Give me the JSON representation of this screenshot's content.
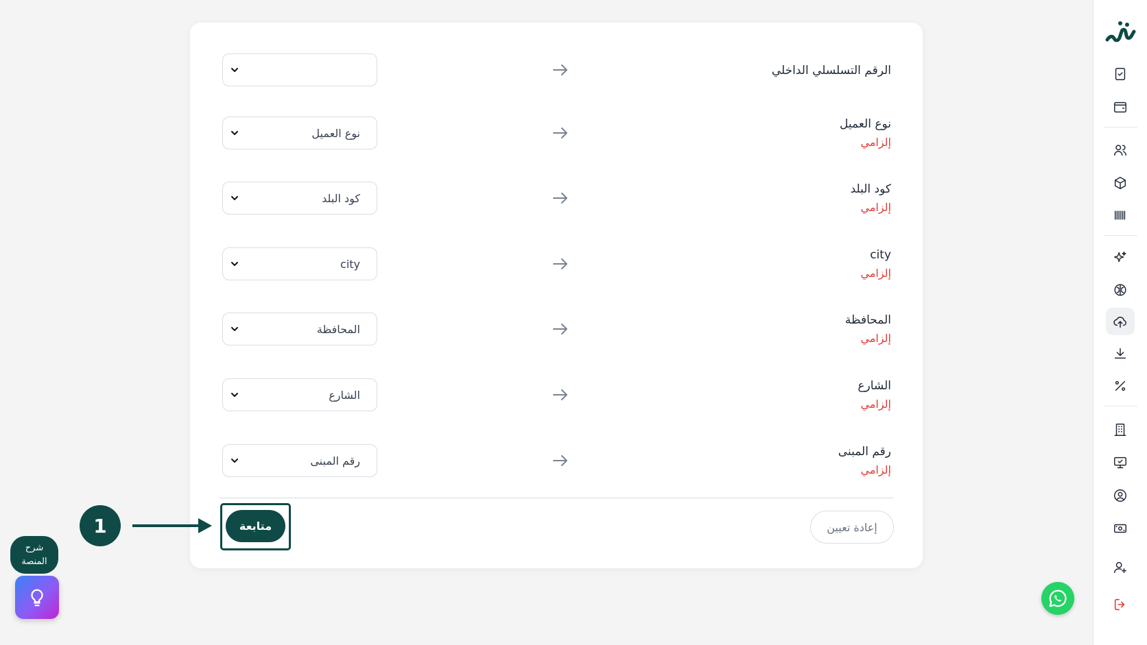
{
  "mapping": {
    "rows": [
      {
        "field": "الرقم التسلسلي الداخلي",
        "required": "",
        "selected": ""
      },
      {
        "field": "نوع العميل",
        "required": "إلزامي",
        "selected": "نوع العميل"
      },
      {
        "field": "كود البلد",
        "required": "إلزامي",
        "selected": "كود البلد"
      },
      {
        "field": "city",
        "required": "إلزامي",
        "selected": "city"
      },
      {
        "field": "المحافظة",
        "required": "إلزامي",
        "selected": "المحافظة"
      },
      {
        "field": "الشارع",
        "required": "إلزامي",
        "selected": "الشارع"
      },
      {
        "field": "رقم المبنى",
        "required": "إلزامي",
        "selected": "رقم المبنى"
      }
    ]
  },
  "actions": {
    "reset_label": "إعادة تعيين",
    "continue_label": "متابعة"
  },
  "annotation": {
    "step_number": "1"
  },
  "help": {
    "line1": "شرح",
    "line2": "المنصة"
  },
  "sidebar": {
    "icons": [
      "tasks-icon",
      "wallet-icon",
      "users-icon",
      "package-icon",
      "barcode-icon",
      "sparkles-icon",
      "brain-icon",
      "cloud-upload-icon",
      "download-icon",
      "percent-icon",
      "building-icon",
      "monitor-icon",
      "user-circle-icon",
      "cash-icon",
      "user-plus-icon",
      "logout-icon"
    ],
    "active": "cloud-upload-icon"
  },
  "colors": {
    "brand": "#0f4a46",
    "required": "#e53935",
    "whatsapp": "#25d366"
  }
}
